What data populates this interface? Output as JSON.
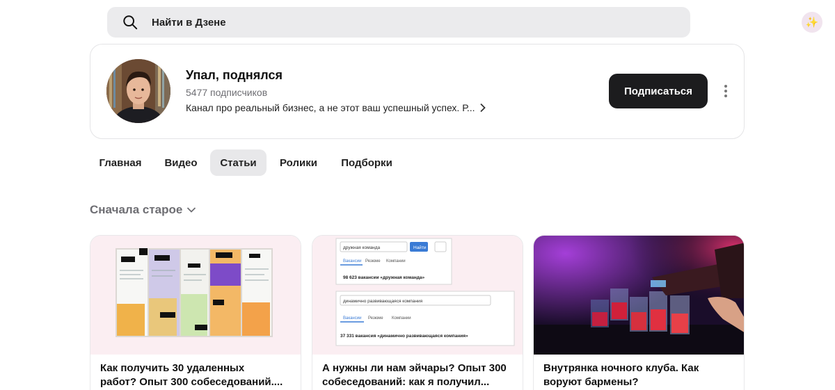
{
  "search": {
    "placeholder": "Найти в Дзене"
  },
  "channel": {
    "title": "Упал, поднялся",
    "subscribers": "5477 подписчиков",
    "description": "Канал про реальный бизнес, а не этот ваш успешный успех. Р...",
    "subscribe_label": "Подписаться"
  },
  "tabs": [
    {
      "label": "Главная",
      "active": false
    },
    {
      "label": "Видео",
      "active": false
    },
    {
      "label": "Статьи",
      "active": true
    },
    {
      "label": "Ролики",
      "active": false
    },
    {
      "label": "Подборки",
      "active": false
    }
  ],
  "sort": {
    "label": "Сначала старое"
  },
  "cards": [
    {
      "title_line1": "Как получить 30 удаленных",
      "title_line2": "работ? Опыт 300 собеседований...."
    },
    {
      "title_line1": "А нужны ли нам эйчары? Опыт 300",
      "title_line2": "собеседований: как я получил...",
      "img": {
        "search1": "дружная команда",
        "button": "Найти",
        "tabs": [
          "Вакансии",
          "Резюме",
          "Компании"
        ],
        "result1": "98 623 вакансии «дружная команда»",
        "search2": "динамично развивающаяся компания",
        "result2": "37 331 вакансия «динамично развивающаяся компания»"
      }
    },
    {
      "title_line1": "Внутрянка ночного клуба. Как",
      "title_line2": "воруют бармены?"
    }
  ]
}
